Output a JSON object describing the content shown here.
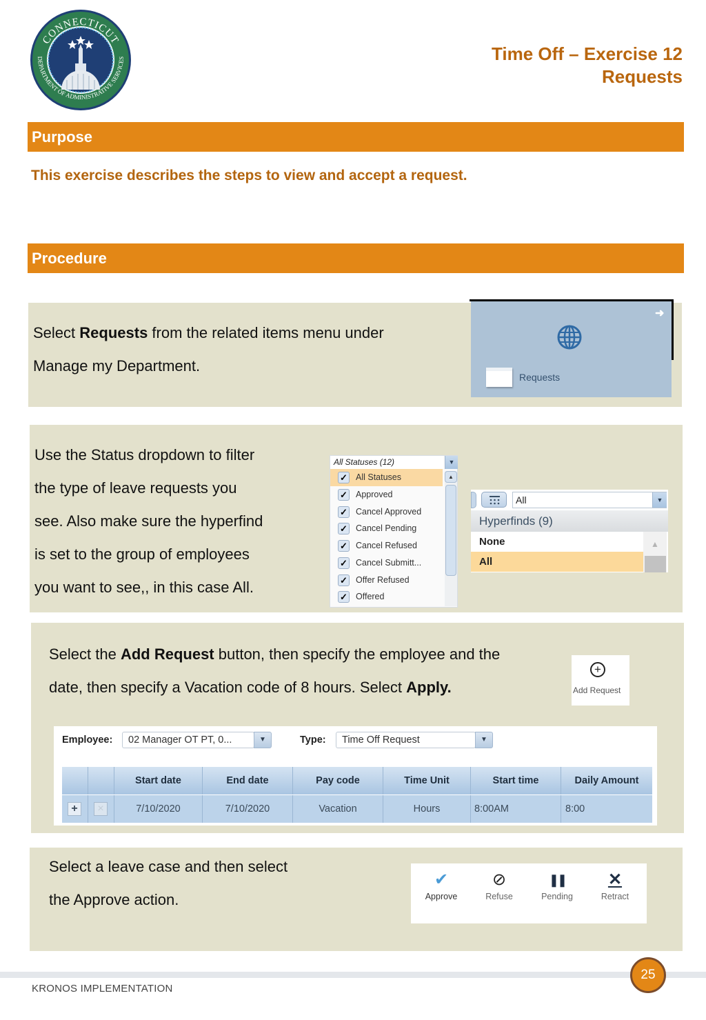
{
  "header": {
    "logo": {
      "top_text": "CONNECTICUT",
      "ring_text": "DEPARTMENT OF ADMINISTRATIVE SERVICES",
      "colors": {
        "ring": "#2e7d4f",
        "center": "#1f3f75"
      }
    },
    "title_line1": "Time Off – Exercise 12",
    "title_line2": "Requests"
  },
  "purpose": {
    "heading": "Purpose",
    "text": "This exercise describes the steps to view and accept a request."
  },
  "procedure": {
    "heading": "Procedure"
  },
  "steps": [
    {
      "line1_pre": "Select ",
      "line1_bold": "Requests",
      "line1_post": " from the related items menu under",
      "line2": "Manage my Department.",
      "tile": {
        "label": "Requests",
        "icon": "globe-icon",
        "arrow_icon": "arrow-right-icon"
      }
    },
    {
      "lines": [
        "Use the Status dropdown to filter",
        "the type of leave requests you",
        "see. Also make sure the hyperfind",
        "is set to the group of employees",
        "you want to see,, in this case All."
      ],
      "status_dropdown": {
        "header": "All Statuses (12)",
        "items": [
          {
            "label": "All Statuses",
            "checked": true,
            "selected": true
          },
          {
            "label": "Approved",
            "checked": true
          },
          {
            "label": "Cancel Approved",
            "checked": true
          },
          {
            "label": "Cancel Pending",
            "checked": true
          },
          {
            "label": "Cancel Refused",
            "checked": true
          },
          {
            "label": "Cancel Submitt...",
            "checked": true
          },
          {
            "label": "Offer Refused",
            "checked": true
          },
          {
            "label": "Offered",
            "checked": true
          }
        ]
      },
      "hyperfind": {
        "value": "All",
        "header": "Hyperfinds (9)",
        "items": [
          {
            "label": "None",
            "selected": false
          },
          {
            "label": "All",
            "selected": true
          }
        ]
      }
    },
    {
      "line1_pre": "Select the ",
      "line1_bold": "Add Request",
      "line1_post": " button, then specify the employee and the",
      "line2_pre": "date, then specify a Vacation code of 8 hours. Select ",
      "line2_bold": "Apply.",
      "add_request_label": "Add Request",
      "form": {
        "employee_label": "Employee:",
        "employee_value": "02 Manager OT PT, 0...",
        "type_label": "Type:",
        "type_value": "Time Off Request",
        "columns": [
          "",
          "",
          "Start date",
          "End date",
          "Pay code",
          "Time Unit",
          "Start time",
          "Daily Amount"
        ],
        "rows": [
          [
            "+",
            "×",
            "7/10/2020",
            "7/10/2020",
            "Vacation",
            "Hours",
            "8:00AM",
            "8:00"
          ]
        ]
      }
    },
    {
      "line1": "Select a leave case and then select",
      "line2": "the Approve action.",
      "actions": [
        {
          "label": "Approve",
          "icon": "✔",
          "color": "#4a9bd6"
        },
        {
          "label": "Refuse",
          "icon": "⊘",
          "color": "#222222"
        },
        {
          "label": "Pending",
          "icon": "❚❚",
          "color": "#1f2f44"
        },
        {
          "label": "Retract",
          "icon": "✕",
          "color": "#1f2f44"
        }
      ]
    }
  ],
  "footer": {
    "text": "KRONOS IMPLEMENTATION",
    "page_number": "25"
  },
  "colors": {
    "accent_orange": "#e38716",
    "title_brown": "#b9660e",
    "panel_bg": "#e3e1cc"
  }
}
